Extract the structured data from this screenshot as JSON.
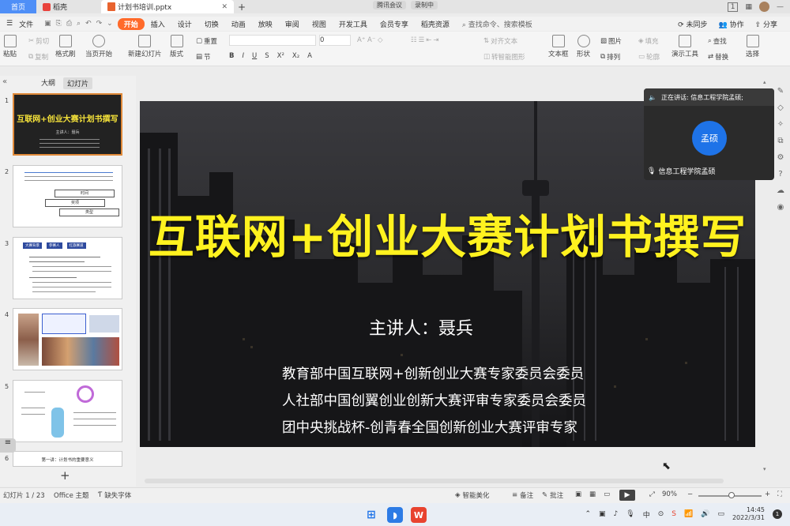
{
  "titlebar": {
    "tabs": [
      {
        "label": "首页"
      },
      {
        "label": "稻壳"
      },
      {
        "label": "计划书培训.pptx"
      }
    ],
    "meeting_badges": [
      "腾讯会议",
      "录制中"
    ],
    "right_badge": "1"
  },
  "menubar": {
    "file": "文件",
    "items": [
      "开始",
      "插入",
      "设计",
      "切换",
      "动画",
      "放映",
      "审阅",
      "视图",
      "开发工具",
      "会员专享",
      "稻壳资源"
    ],
    "search": "查找命令、搜索模板",
    "right": {
      "sync": "未同步",
      "collab": "协作",
      "share": "分享"
    }
  },
  "ribbon": {
    "paste": "粘贴",
    "cut": "剪切",
    "copy": "复制",
    "format_painter": "格式刷",
    "start_from_current": "当页开始",
    "new_slide": "新建幻灯片",
    "layout": "版式",
    "reset": "重置",
    "section": "节",
    "font_name": "",
    "font_size": "0",
    "text_box": "文本框",
    "shape": "形状",
    "arrange": "排列",
    "outline": "轮廓",
    "picture": "图片",
    "fill": "填充",
    "find": "查找",
    "replace": "替换",
    "select": "选择",
    "slideshow_tools": "演示工具",
    "convert_smartart": "转智能图形",
    "align_text": "对齐文本"
  },
  "leftpanel": {
    "tab_outline": "大纲",
    "tab_slides": "幻灯片",
    "thumb_numbers": [
      "1",
      "2",
      "3",
      "4",
      "5",
      "6"
    ],
    "thumb1_title": "互联网+创业大赛计划书撰写",
    "thumb1_sub": "主讲人：聂兵",
    "thumb2_labels": [
      "时间",
      "奖项",
      "类型"
    ],
    "thumb3_tags": [
      "大赛背景",
      "参赛人",
      "红旅赛道"
    ],
    "thumb6_text": "第一讲：计划书的重要意义"
  },
  "slide": {
    "title": "互联网+创业大赛计划书撰写",
    "speaker": "主讲人：聂兵",
    "bio_lines": [
      "教育部中国互联网+创新创业大赛专家委员会委员",
      "人社部中国创翼创业创新大赛评审专家委员会委员",
      "团中央挑战杯-创青春全国创新创业大赛评审专家"
    ]
  },
  "meeting": {
    "speaking_label": "正在讲话: 信息工程学院孟硕;",
    "avatar_text": "孟硕",
    "participant_name": "信息工程学院孟硕"
  },
  "statusbar": {
    "slide_counter": "幻灯片 1 / 23",
    "theme": "Office 主题",
    "missing_font": "缺失字体",
    "smart_beautify": "智能美化",
    "notes": "备注",
    "comments": "批注",
    "zoom": "90%"
  },
  "taskbar": {
    "time": "14:45",
    "date": "2022/3/31",
    "lang": "中",
    "notification_count": "1"
  },
  "colors": {
    "accent_orange": "#ff6a2a",
    "home_tab_blue": "#4f8ff7",
    "title_yellow": "#fff21f",
    "meeting_avatar_blue": "#1e73e8"
  }
}
